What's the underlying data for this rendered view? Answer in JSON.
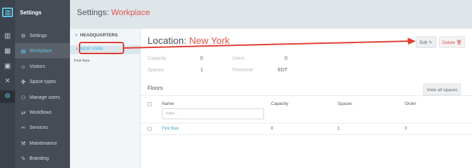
{
  "sidebar": {
    "title": "Settings",
    "items": [
      {
        "label": "Settings",
        "icon": "gear-icon",
        "glyph": "⚙"
      },
      {
        "label": "Workplace",
        "icon": "building-icon",
        "glyph": "▤"
      },
      {
        "label": "Visitors",
        "icon": "badge-icon",
        "glyph": "☺"
      },
      {
        "label": "Space types",
        "icon": "shapes-icon",
        "glyph": "✤"
      },
      {
        "label": "Manage users",
        "icon": "users-icon",
        "glyph": "⚇"
      },
      {
        "label": "Workflows",
        "icon": "flow-icon",
        "glyph": "⇄"
      },
      {
        "label": "Services",
        "icon": "tools-icon",
        "glyph": "✂"
      },
      {
        "label": "Maintenance",
        "icon": "wrench-icon",
        "glyph": "⚒"
      },
      {
        "label": "Branding",
        "icon": "palette-icon",
        "glyph": "✎"
      }
    ],
    "active_color": "#5fc3e4"
  },
  "header": {
    "prefix": "Settings:",
    "accent": "Workplace"
  },
  "tree": {
    "parent": "HEADQUARTERS",
    "selected": "NEW YORK",
    "child": "First floor"
  },
  "location": {
    "label": "Location:",
    "name": "New York",
    "edit_label": "Edit",
    "delete_label": "Delete",
    "stats": {
      "capacity_label": "Capacity",
      "capacity": "0",
      "users_label": "Users",
      "users": "0",
      "spaces_label": "Spaces",
      "spaces": "1",
      "timezone_label": "Timezone",
      "timezone": "EDT"
    }
  },
  "floors": {
    "title": "Floors",
    "view_all_label": "View all spaces",
    "columns": [
      "Name",
      "Capacity",
      "Spaces",
      "Order"
    ],
    "filter_placeholder": "Filter...",
    "rows": [
      {
        "name": "First floor",
        "capacity": "0",
        "spaces": "1",
        "order": "0"
      }
    ]
  },
  "colors": {
    "accent_red": "#e0534a",
    "accent_blue": "#5fc3e4",
    "annotation_red": "#e03b2f"
  }
}
